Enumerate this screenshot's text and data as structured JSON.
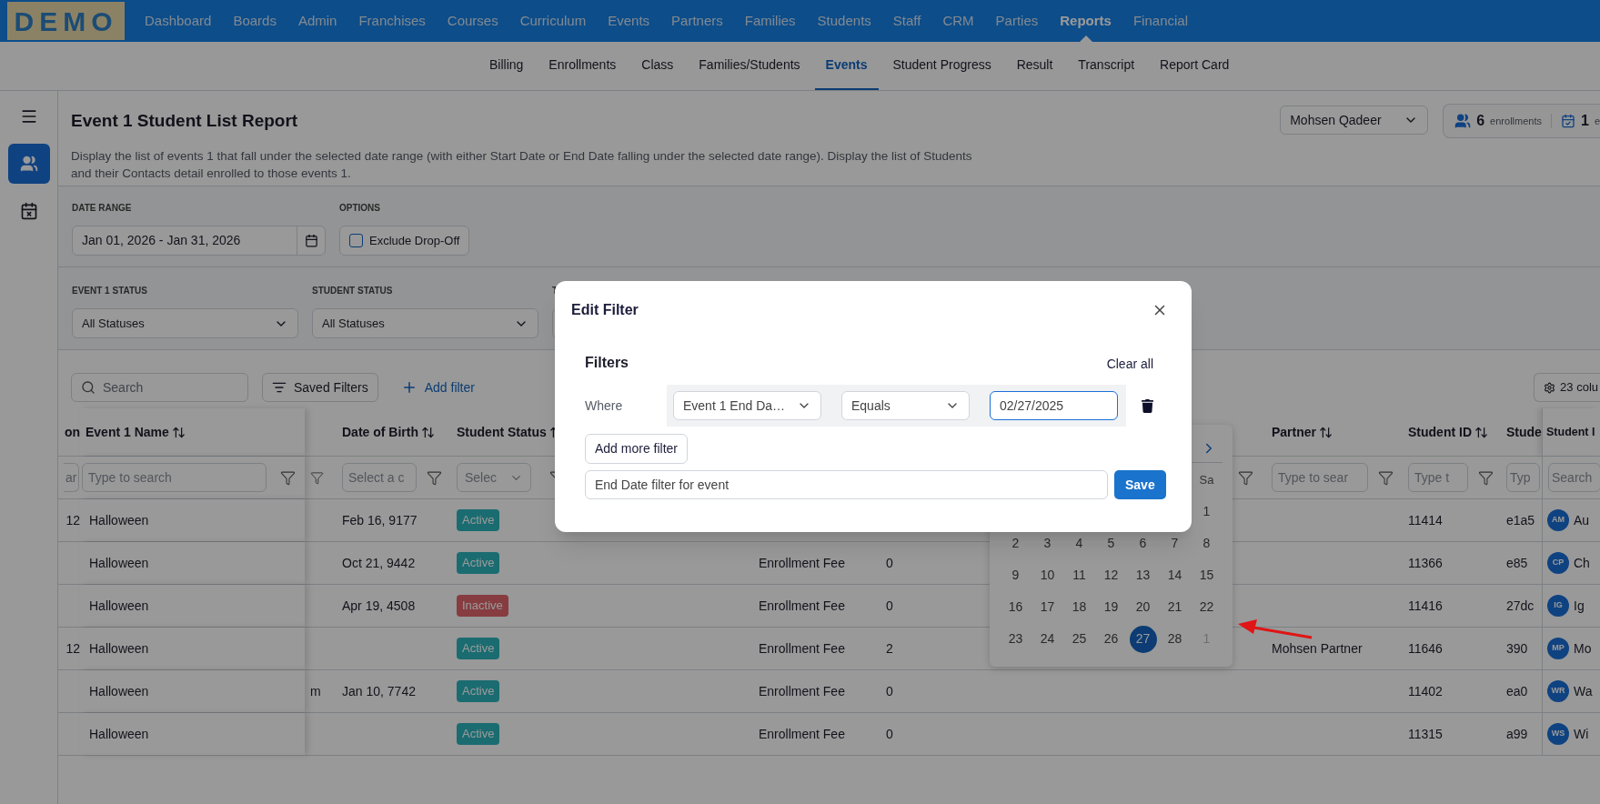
{
  "nav": {
    "logo": "DEMO",
    "items": [
      {
        "label": "Dashboard",
        "selected": false
      },
      {
        "label": "Boards",
        "selected": false
      },
      {
        "label": "Admin",
        "selected": false
      },
      {
        "label": "Franchises",
        "selected": false
      },
      {
        "label": "Courses",
        "selected": false
      },
      {
        "label": "Curriculum",
        "selected": false
      },
      {
        "label": "Events",
        "selected": false
      },
      {
        "label": "Partners",
        "selected": false
      },
      {
        "label": "Families",
        "selected": false
      },
      {
        "label": "Students",
        "selected": false
      },
      {
        "label": "Staff",
        "selected": false
      },
      {
        "label": "CRM",
        "selected": false
      },
      {
        "label": "Parties",
        "selected": false
      },
      {
        "label": "Reports",
        "selected": true
      },
      {
        "label": "Financial",
        "selected": false
      }
    ]
  },
  "subnav": {
    "items": [
      {
        "label": "Billing",
        "selected": false
      },
      {
        "label": "Enrollments",
        "selected": false
      },
      {
        "label": "Class",
        "selected": false
      },
      {
        "label": "Families/Students",
        "selected": false
      },
      {
        "label": "Events",
        "selected": true
      },
      {
        "label": "Student Progress",
        "selected": false
      },
      {
        "label": "Result",
        "selected": false
      },
      {
        "label": "Transcript",
        "selected": false
      },
      {
        "label": "Report Card",
        "selected": false
      }
    ]
  },
  "sidebar": {
    "items": [
      {
        "kind": "menu",
        "selected": false
      },
      {
        "kind": "students",
        "selected": true
      },
      {
        "kind": "events",
        "selected": false
      }
    ]
  },
  "header": {
    "title": "Event 1 Student List Report",
    "description": "Display the list of events 1 that fall under the selected date range (with either Start Date or End Date falling under the selected date range). Display the list of Students and their Contacts detail enrolled to those events 1.",
    "user_select": "Mohsen Qadeer",
    "stats": [
      {
        "kind": "students",
        "count": "6",
        "label": "enrollments"
      },
      {
        "kind": "events",
        "count": "1",
        "label": "e"
      }
    ]
  },
  "filters": {
    "date_range": {
      "label": "DATE RANGE",
      "value": "Jan 01, 2026 - Jan 31, 2026"
    },
    "options": {
      "label": "OPTIONS",
      "checkbox": {
        "label": "Exclude Drop-Off",
        "checked": false
      }
    },
    "selects": [
      {
        "label": "EVENT 1 STATUS",
        "value": "All Statuses"
      },
      {
        "label": "STUDENT STATUS",
        "value": "All Statuses"
      },
      {
        "label": "T"
      }
    ]
  },
  "toolbar": {
    "search_placeholder": "Search",
    "saved_filters": "Saved Filters",
    "add_filter": "Add filter",
    "columns_button": "23 colu"
  },
  "table": {
    "columns": [
      {
        "label": "on",
        "filter": {
          "kind": "text",
          "placeholder": "ar"
        }
      },
      {
        "label": "Event 1 Name",
        "sortable": true,
        "filter": {
          "kind": "text",
          "placeholder": "Type to search",
          "funnel": true
        }
      },
      {
        "filter": {
          "kind": "none",
          "funnel": true
        }
      },
      {
        "label": "Date of Birth",
        "sortable": true,
        "filter": {
          "kind": "text",
          "placeholder": "Select a c",
          "funnel": true
        }
      },
      {
        "label": "Student Status",
        "sortable": true,
        "filter": {
          "kind": "select",
          "placeholder": "Selec",
          "funnel": true
        }
      },
      {},
      {},
      {},
      {
        "filter": {
          "kind": "none",
          "funnel": true
        }
      },
      {
        "label": "Partner",
        "sortable": true,
        "filter": {
          "kind": "text",
          "placeholder": "Type to sear",
          "funnel": true
        }
      },
      {
        "label": "Student ID",
        "sortable": true,
        "filter": {
          "kind": "text",
          "placeholder": "Type t",
          "funnel": true
        }
      },
      {
        "label": "Stude",
        "filter": {
          "kind": "text",
          "placeholder": "Typ"
        }
      },
      {
        "label": "Student I",
        "filter": {
          "kind": "text",
          "placeholder": "Search"
        }
      }
    ],
    "rows": [
      {
        "column_1": "12",
        "event_1_name": "Halloween",
        "date_of_birth": "Feb 16, 9177",
        "student_status": {
          "label": "Active",
          "kind": "active"
        },
        "student_id": "11414",
        "column_12": "e1a5",
        "column_13": {
          "initials": "AM",
          "name": "Au"
        }
      },
      {
        "event_1_name": "Halloween",
        "date_of_birth": "Oct 21, 9442",
        "student_status": {
          "label": "Active",
          "kind": "active"
        },
        "column_7": "Enrollment Fee",
        "column_8": "0",
        "student_id": "11366",
        "column_12": "e85",
        "column_13": {
          "initials": "CP",
          "name": "Ch"
        }
      },
      {
        "event_1_name": "Halloween",
        "date_of_birth": "Apr 19, 4508",
        "student_status": {
          "label": "Inactive",
          "kind": "inactive"
        },
        "column_7": "Enrollment Fee",
        "column_8": "0",
        "student_id": "11416",
        "column_12": "27dc",
        "column_13": {
          "initials": "IG",
          "name": "Ig"
        }
      },
      {
        "column_1": "12",
        "event_1_name": "Halloween",
        "student_status": {
          "label": "Active",
          "kind": "active"
        },
        "column_7": "Enrollment Fee",
        "column_8": "2",
        "partner": "Mohsen Partner",
        "student_id": "11646",
        "column_12": "390",
        "column_13": {
          "initials": "MP",
          "name": "Mo"
        }
      },
      {
        "event_1_name": "Halloween",
        "column_3": "m",
        "date_of_birth": "Jan 10, 7742",
        "student_status": {
          "label": "Active",
          "kind": "active"
        },
        "column_7": "Enrollment Fee",
        "column_8": "0",
        "student_id": "11402",
        "column_12": "ea0",
        "column_13": {
          "initials": "WR",
          "name": "Wa"
        }
      },
      {
        "event_1_name": "Halloween",
        "student_status": {
          "label": "Active",
          "kind": "active"
        },
        "column_7": "Enrollment Fee",
        "column_8": "0",
        "student_id": "11315",
        "column_12": "a99",
        "column_13": {
          "initials": "WS",
          "name": "Wi"
        }
      }
    ]
  },
  "calendar": {
    "weekday_headers": [
      "Sa"
    ],
    "weeks": [
      {
        "days": [
          {
            "label": "1",
            "selected": false,
            "muted": false
          }
        ]
      },
      {
        "days": [
          {
            "label": "2",
            "selected": false,
            "muted": false
          },
          {
            "label": "3",
            "selected": false,
            "muted": false
          },
          {
            "label": "4",
            "selected": false,
            "muted": false
          },
          {
            "label": "5",
            "selected": false,
            "muted": false
          },
          {
            "label": "6",
            "selected": false,
            "muted": false
          },
          {
            "label": "7",
            "selected": false,
            "muted": false
          },
          {
            "label": "8",
            "selected": false,
            "muted": false
          }
        ]
      },
      {
        "days": [
          {
            "label": "9",
            "selected": false,
            "muted": false
          },
          {
            "label": "10",
            "selected": false,
            "muted": false
          },
          {
            "label": "11",
            "selected": false,
            "muted": false
          },
          {
            "label": "12",
            "selected": false,
            "muted": false
          },
          {
            "label": "13",
            "selected": false,
            "muted": false
          },
          {
            "label": "14",
            "selected": false,
            "muted": false
          },
          {
            "label": "15",
            "selected": false,
            "muted": false
          }
        ]
      },
      {
        "days": [
          {
            "label": "16",
            "selected": false,
            "muted": false
          },
          {
            "label": "17",
            "selected": false,
            "muted": false
          },
          {
            "label": "18",
            "selected": false,
            "muted": false
          },
          {
            "label": "19",
            "selected": false,
            "muted": false
          },
          {
            "label": "20",
            "selected": false,
            "muted": false
          },
          {
            "label": "21",
            "selected": false,
            "muted": false
          },
          {
            "label": "22",
            "selected": false,
            "muted": false
          }
        ]
      },
      {
        "days": [
          {
            "label": "23",
            "selected": false,
            "muted": false
          },
          {
            "label": "24",
            "selected": false,
            "muted": false
          },
          {
            "label": "25",
            "selected": false,
            "muted": false
          },
          {
            "label": "26",
            "selected": false,
            "muted": false
          },
          {
            "label": "27",
            "selected": true,
            "muted": false
          },
          {
            "label": "28",
            "selected": false,
            "muted": false
          },
          {
            "label": "1",
            "selected": false,
            "muted": true
          }
        ]
      }
    ]
  },
  "modal": {
    "title": "Edit Filter",
    "section_title": "Filters",
    "clear_all": "Clear all",
    "rows": [
      {
        "label": "Where",
        "field": "Event 1 End Da…",
        "operator": "Equals",
        "value": "02/27/2025"
      }
    ],
    "add_button": "Add more filter",
    "name_value": "End Date filter for event",
    "save_button": "Save"
  }
}
